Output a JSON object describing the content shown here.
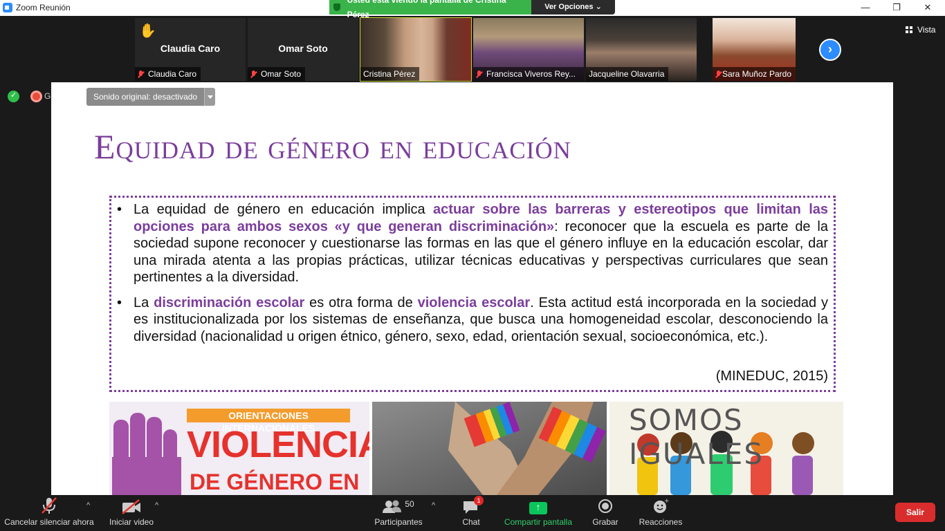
{
  "window": {
    "title": "Zoom Reunión",
    "minimize": "—",
    "maximize": "❐",
    "close": "✕"
  },
  "share_banner": {
    "text": "Usted está viendo la pantalla de Cristina Pérez",
    "options": "Ver Opciones ⌄"
  },
  "participants_strip": [
    {
      "name": "Claudia Caro",
      "label": "Claudia Caro",
      "video": false,
      "hand_raised": true,
      "muted": true
    },
    {
      "name": "Omar Soto",
      "label": "Omar Soto",
      "video": false,
      "hand_raised": false,
      "muted": true
    },
    {
      "label": "Cristina Pérez",
      "video": true,
      "muted": false,
      "active_speaker": true
    },
    {
      "label": "Francisca Viveros Rey...",
      "video": true,
      "muted": true
    },
    {
      "label": "Jacqueline Olavarria",
      "video": true,
      "muted": false
    },
    {
      "label": "Sara Muñoz Pardo",
      "video": true,
      "muted": true
    }
  ],
  "next_page_icon": "chevron-right-icon",
  "view": {
    "label": "Vista",
    "icon": "grid-icon"
  },
  "left_indicators": {
    "rec_label": "G"
  },
  "slide": {
    "original_sound": "Sonido original: desactivado",
    "title": "Equidad de género en educación",
    "bullet1": {
      "t1": "La equidad de género en educación implica ",
      "h1": "actuar sobre las barreras y estereotipos que limitan las opciones para ambos sexos «y que generan discriminación»",
      "t2": ": reconocer que la escuela es parte de la sociedad supone reconocer y cuestionarse las formas en las que el género influye en la educación escolar, dar una mirada atenta a las propias prácticas, utilizar técnicas educativas y perspectivas curriculares que sean pertinentes a la diversidad."
    },
    "bullet2": {
      "t1": "La ",
      "h1": "discriminación escolar",
      "t2": " es otra forma de ",
      "h2": "violencia escolar",
      "t3": ". Esta actitud está incorporada en la sociedad y es institucionalizada por los sistemas de enseñanza, que busca una homogeneidad escolar, desconociendo la diversidad (nacionalidad u origen étnico, género, sexo, edad, orientación sexual, socioeconómica, etc.)."
    },
    "citation": "(MINEDUC, 2015)",
    "images": {
      "img1_banner": "ORIENTACIONES INTERNACIONALES",
      "img1_big": "VIOLENCIA",
      "img1_sub": "DE GÉNERO EN EL",
      "img3_text": "SOMOS IGUALES"
    },
    "colors": {
      "accent": "#7b3d9c"
    }
  },
  "toolbar": {
    "mute": "Cancelar silenciar ahora",
    "video": "Iniciar video",
    "participants": "Participantes",
    "participants_count": "50",
    "chat": "Chat",
    "chat_badge": "1",
    "share": "Compartir pantalla",
    "record": "Grabar",
    "reactions": "Reacciones",
    "leave": "Salir"
  }
}
